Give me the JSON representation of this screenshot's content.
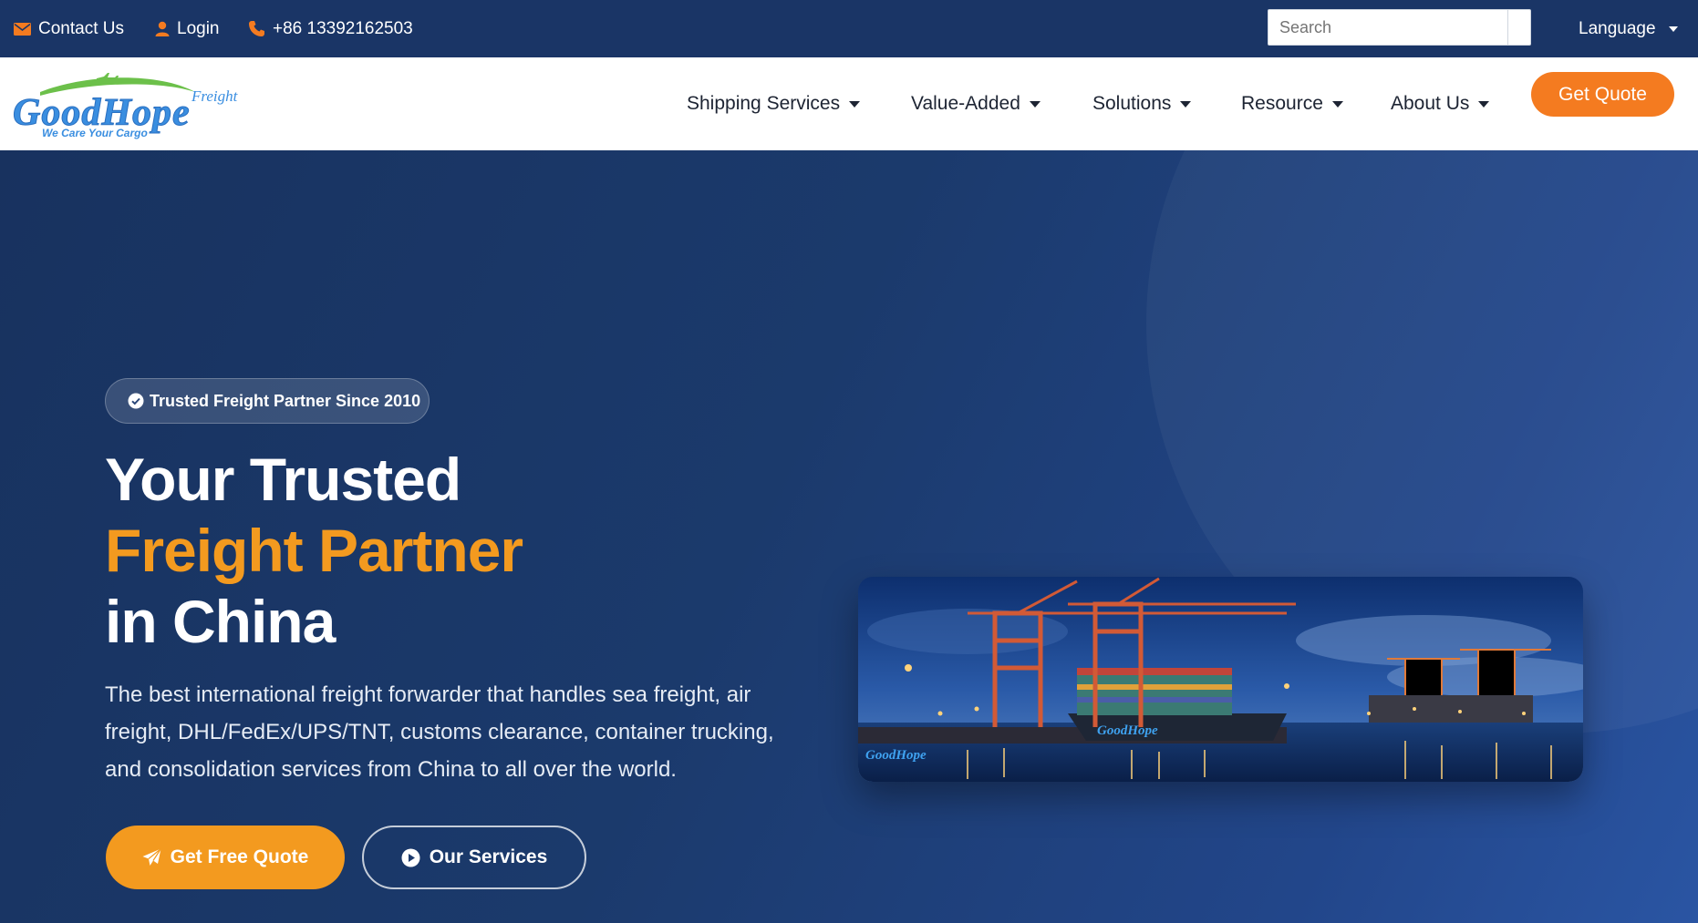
{
  "topbar": {
    "contact": "Contact Us",
    "login": "Login",
    "phone": "+86 13392162503",
    "search_placeholder": "Search",
    "language": "Language"
  },
  "logo": {
    "brand": "GoodHope",
    "sub": "Freight",
    "tagline": "We Care Your Cargo"
  },
  "nav": {
    "items": [
      {
        "label": "Shipping Services"
      },
      {
        "label": "Value-Added"
      },
      {
        "label": "Solutions"
      },
      {
        "label": "Resource"
      },
      {
        "label": "About Us"
      }
    ],
    "cta": "Get Quote"
  },
  "hero": {
    "badge": "Trusted Freight Partner Since 2010",
    "headline_line1": "Your Trusted",
    "headline_line2": "Freight Partner",
    "headline_line3": "in China",
    "description": "The best international freight forwarder that handles sea freight, air freight, DHL/FedEx/UPS/TNT, customs clearance, container trucking, and consolidation services from China to all over the world.",
    "primary_button": "Get Free Quote",
    "secondary_button": "Our Services"
  },
  "colors": {
    "navy": "#1a3566",
    "orange_cta": "#f47b20",
    "gold_accent": "#f39a1f",
    "logo_blue": "#3a8ee0",
    "logo_green": "#6cc04a"
  },
  "icons": {
    "contact": "envelope-icon",
    "login": "user-icon",
    "phone": "phone-icon",
    "language": "caret-down-icon",
    "badge": "check-circle-icon",
    "primary_button": "paper-plane-icon",
    "secondary_button": "play-circle-icon"
  }
}
